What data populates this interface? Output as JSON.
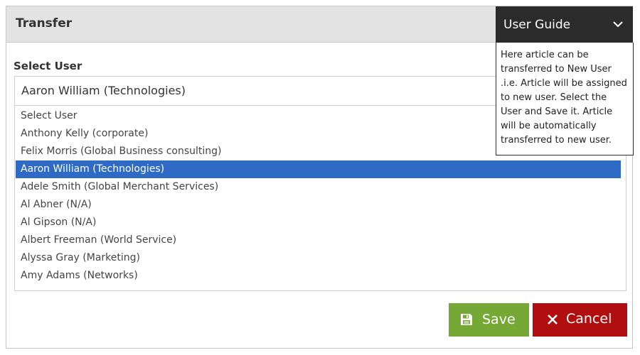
{
  "dialog": {
    "title": "Transfer"
  },
  "user_guide": {
    "toggle_label": "User Guide",
    "icon": "chevron-down-icon",
    "text": "Here article can be transferred to New User .i.e. Article will be assigned to new user. Select the User and Save it. Article will be automatically transferred to new user."
  },
  "form": {
    "select_label": "Select User",
    "selected_value": "Aaron William (Technologies)",
    "options": [
      "Select User",
      "Anthony Kelly (corporate)",
      "Felix Morris (Global Business consulting)",
      "Aaron William (Technologies)",
      "Adele Smith (Global Merchant Services)",
      "Al Abner (N/A)",
      "Al Gipson (N/A)",
      "Albert Freeman (World Service)",
      "Alyssa Gray (Marketing)",
      "Amy Adams (Networks)"
    ],
    "selected_index": 3
  },
  "actions": {
    "save_label": "Save",
    "save_icon": "floppy-disk-icon",
    "cancel_label": "Cancel",
    "cancel_icon": "close-icon"
  },
  "colors": {
    "save": "#75a834",
    "cancel": "#b10f0f",
    "selected_option": "#2f6ac4",
    "guide_header": "#2b2b2b"
  }
}
